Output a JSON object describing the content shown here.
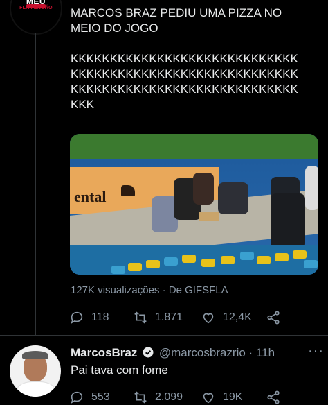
{
  "avatar_top": {
    "line1": "MEU",
    "line2": "FLAMENGÃO"
  },
  "tweet": {
    "text": "MARCOS BRAZ PEDIU UMA PIZZA NO\nMEIO DO JOGO\n\nKKKKKKKKKKKKKKKKKKKKKKKKKKKKK\nKKKKKKKKKKKKKKKKKKKKKKKKKKKKK\nKKKKKKKKKKKKKKKKKKKKKKKKKKKKK\nKKK",
    "media_banner_text": "ental",
    "views": "127K visualizações · De GIFSFLA",
    "replies": "118",
    "retweets": "1.871",
    "likes": "12,4K"
  },
  "reply": {
    "name": "MarcosBraz",
    "handle": "@marcosbrazrio",
    "time": "· 11h",
    "more": "···",
    "text": "Pai tava com fome",
    "replies": "553",
    "retweets": "2.099",
    "likes": "19K"
  },
  "colors": {
    "background": "#000000",
    "muted": "#8b98a5",
    "text": "#e7e9ea",
    "verified": "#e7e9ea"
  },
  "icons": [
    "reply-icon",
    "retweet-icon",
    "like-icon",
    "share-icon",
    "verified-icon",
    "more-icon"
  ]
}
